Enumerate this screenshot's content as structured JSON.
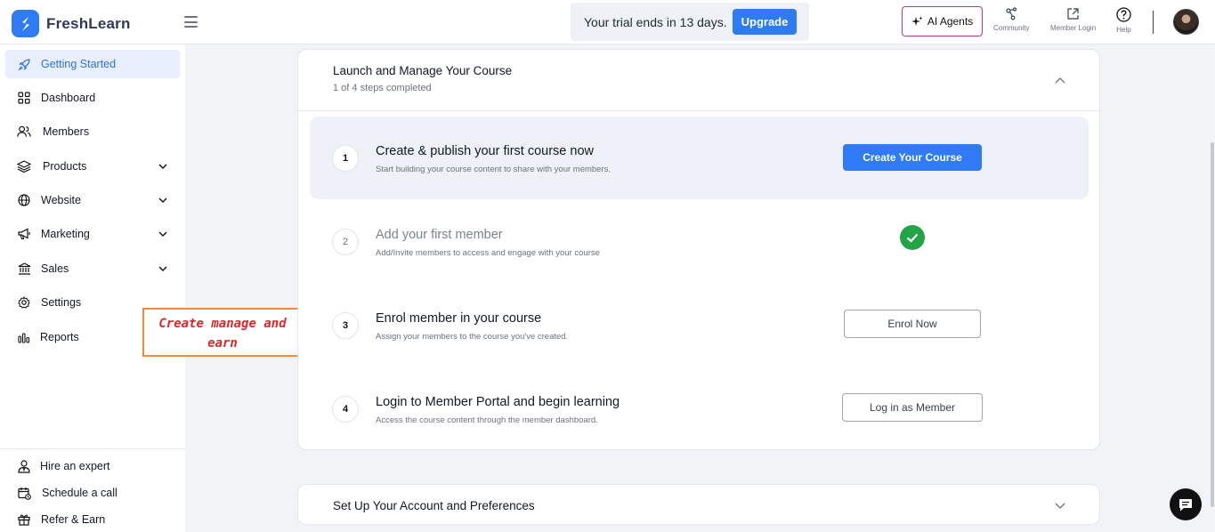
{
  "header": {
    "brand": "FreshLearn",
    "trial_text": "Your trial ends in 13 days.",
    "upgrade_label": "Upgrade",
    "ai_agents_label": "AI Agents",
    "community_label": "Community",
    "member_login_label": "Member Login",
    "help_label": "Help"
  },
  "sidebar": {
    "items": [
      {
        "label": "Getting Started",
        "icon": "rocket-icon",
        "active": true
      },
      {
        "label": "Dashboard",
        "icon": "grid-icon"
      },
      {
        "label": "Members",
        "icon": "users-icon"
      },
      {
        "label": "Products",
        "icon": "layers-icon",
        "expandable": true
      },
      {
        "label": "Website",
        "icon": "globe-icon",
        "expandable": true
      },
      {
        "label": "Marketing",
        "icon": "megaphone-icon",
        "expandable": true
      },
      {
        "label": "Sales",
        "icon": "bank-icon",
        "expandable": true
      },
      {
        "label": "Settings",
        "icon": "gear-icon"
      },
      {
        "label": "Reports",
        "icon": "bar-chart-icon"
      }
    ],
    "bottom_items": [
      {
        "label": "Hire an expert",
        "icon": "expert-icon"
      },
      {
        "label": "Schedule a call",
        "icon": "calendar-icon"
      },
      {
        "label": "Refer & Earn",
        "icon": "gift-icon"
      }
    ]
  },
  "annotation": {
    "line1": "Create manage and",
    "line2": "earn"
  },
  "launch_card": {
    "title": "Launch and Manage Your Course",
    "subtitle": "1 of 4 steps completed",
    "steps": [
      {
        "number": "1",
        "title": "Create & publish your first course now",
        "description": "Start building your course content to share with your members.",
        "action": "Create Your Course"
      },
      {
        "number": "2",
        "title": "Add your first member",
        "description": "Add/Invite members to access and engage with your course",
        "completed": true
      },
      {
        "number": "3",
        "title": "Enrol member in your course",
        "description": "Assign your members to the course you've created.",
        "action": "Enrol Now"
      },
      {
        "number": "4",
        "title": "Login to Member Portal and begin learning",
        "description": "Access the course content through the member dashboard.",
        "action": "Log in as Member"
      }
    ]
  },
  "account_card": {
    "title": "Set Up Your Account and Preferences"
  },
  "colors": {
    "primary": "#2f7bf5",
    "success": "#22a447",
    "annotation_border": "#f08a3c",
    "annotation_text": "#e0262b"
  }
}
